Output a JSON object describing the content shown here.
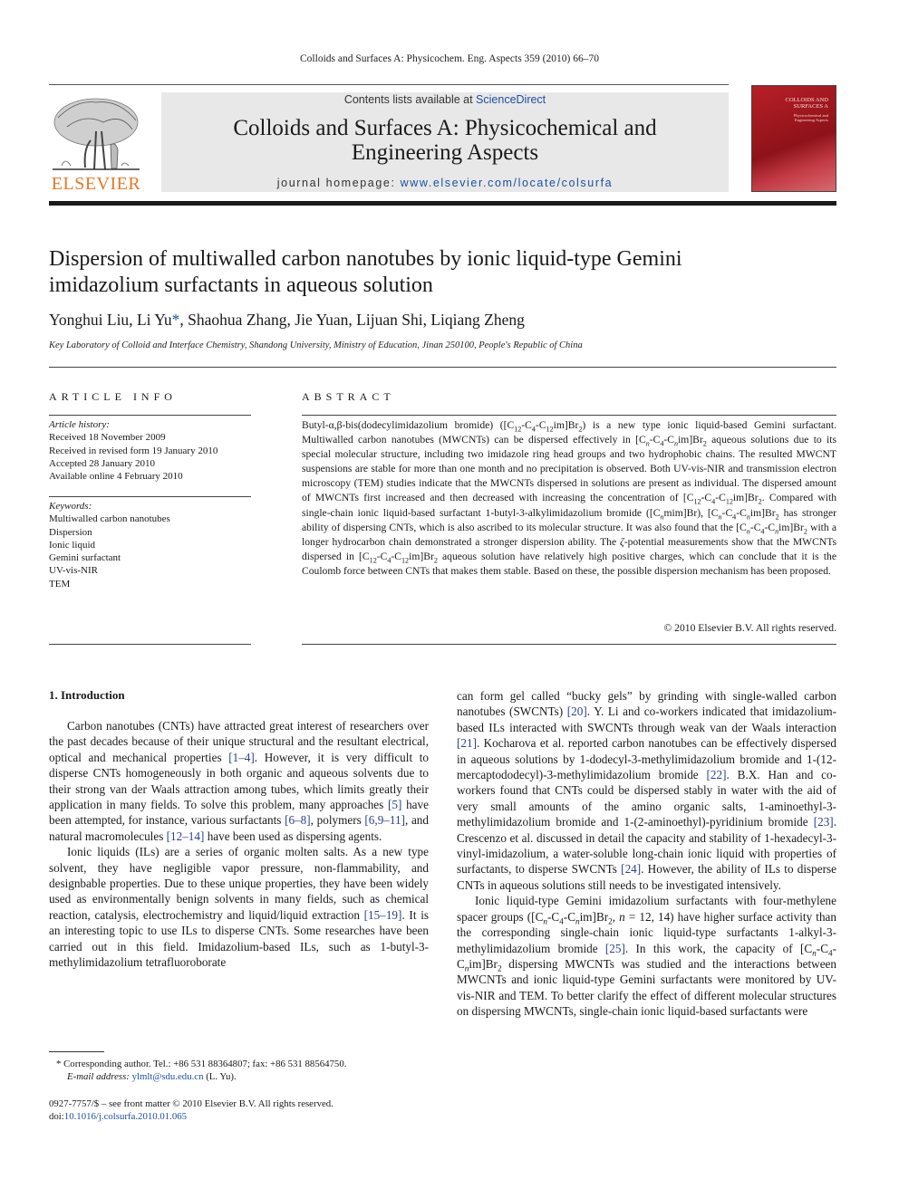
{
  "header": {
    "citation": "Colloids and Surfaces A: Physicochem. Eng. Aspects 359 (2010) 66–70",
    "contents_prefix": "Contents lists available at ",
    "contents_link": "ScienceDirect",
    "journal_title_line1": "Colloids and Surfaces A: Physicochemical and",
    "journal_title_line2": "Engineering Aspects",
    "homepage_prefix": "journal homepage: ",
    "homepage_link": "www.elsevier.com/locate/colsurfa",
    "publisher_logo": "ELSEVIER",
    "cover_title_line1": "COLLOIDS AND",
    "cover_title_line2": "SURFACES A",
    "cover_subtitle_line1": "Physicochemical and",
    "cover_subtitle_line2": "Engineering Aspects"
  },
  "article": {
    "title_line1": "Dispersion of multiwalled carbon nanotubes by ionic liquid-type Gemini",
    "title_line2": "imidazolium surfactants in aqueous solution",
    "authors": [
      {
        "name": "Yonghui Liu",
        "sep": ", "
      },
      {
        "name": "Li Yu",
        "mark": "*",
        "sep": ", "
      },
      {
        "name": "Shaohua Zhang",
        "sep": ", "
      },
      {
        "name": "Jie Yuan",
        "sep": ", "
      },
      {
        "name": "Lijuan Shi",
        "sep": ", "
      },
      {
        "name": "Liqiang Zheng",
        "sep": ""
      }
    ],
    "affiliation": "Key Laboratory of Colloid and Interface Chemistry, Shandong University, Ministry of Education, Jinan 250100, People's Republic of China"
  },
  "article_info": {
    "heading": "ARTICLE INFO",
    "history_label": "Article history:",
    "history": [
      "Received 18 November 2009",
      "Received in revised form 19 January 2010",
      "Accepted 28 January 2010",
      "Available online 4 February 2010"
    ],
    "keywords_label": "Keywords:",
    "keywords": [
      "Multiwalled carbon nanotubes",
      "Dispersion",
      "Ionic liquid",
      "Gemini surfactant",
      "UV-vis-NIR",
      "TEM"
    ]
  },
  "abstract": {
    "heading": "ABSTRACT",
    "copyright": "© 2010 Elsevier B.V. All rights reserved."
  },
  "intro": {
    "heading": "1.  Introduction"
  },
  "footnotes": {
    "corresponding": "*  Corresponding author. Tel.: +86 531 88364807; fax: +86 531 88564750.",
    "email_label": "E-mail address: ",
    "email": "ylmlt@sdu.edu.cn",
    "email_suffix": " (L. Yu).",
    "front_matter": "0927-7757/$ – see front matter © 2010 Elsevier B.V. All rights reserved.",
    "doi_prefix": "doi:",
    "doi": "10.1016/j.colsurfa.2010.01.065"
  },
  "colors": {
    "link": "#1d4fa3",
    "elsevier_orange": "#e87722",
    "cover_red": "#b81f27",
    "masthead_bg": "#e8e8e8"
  }
}
